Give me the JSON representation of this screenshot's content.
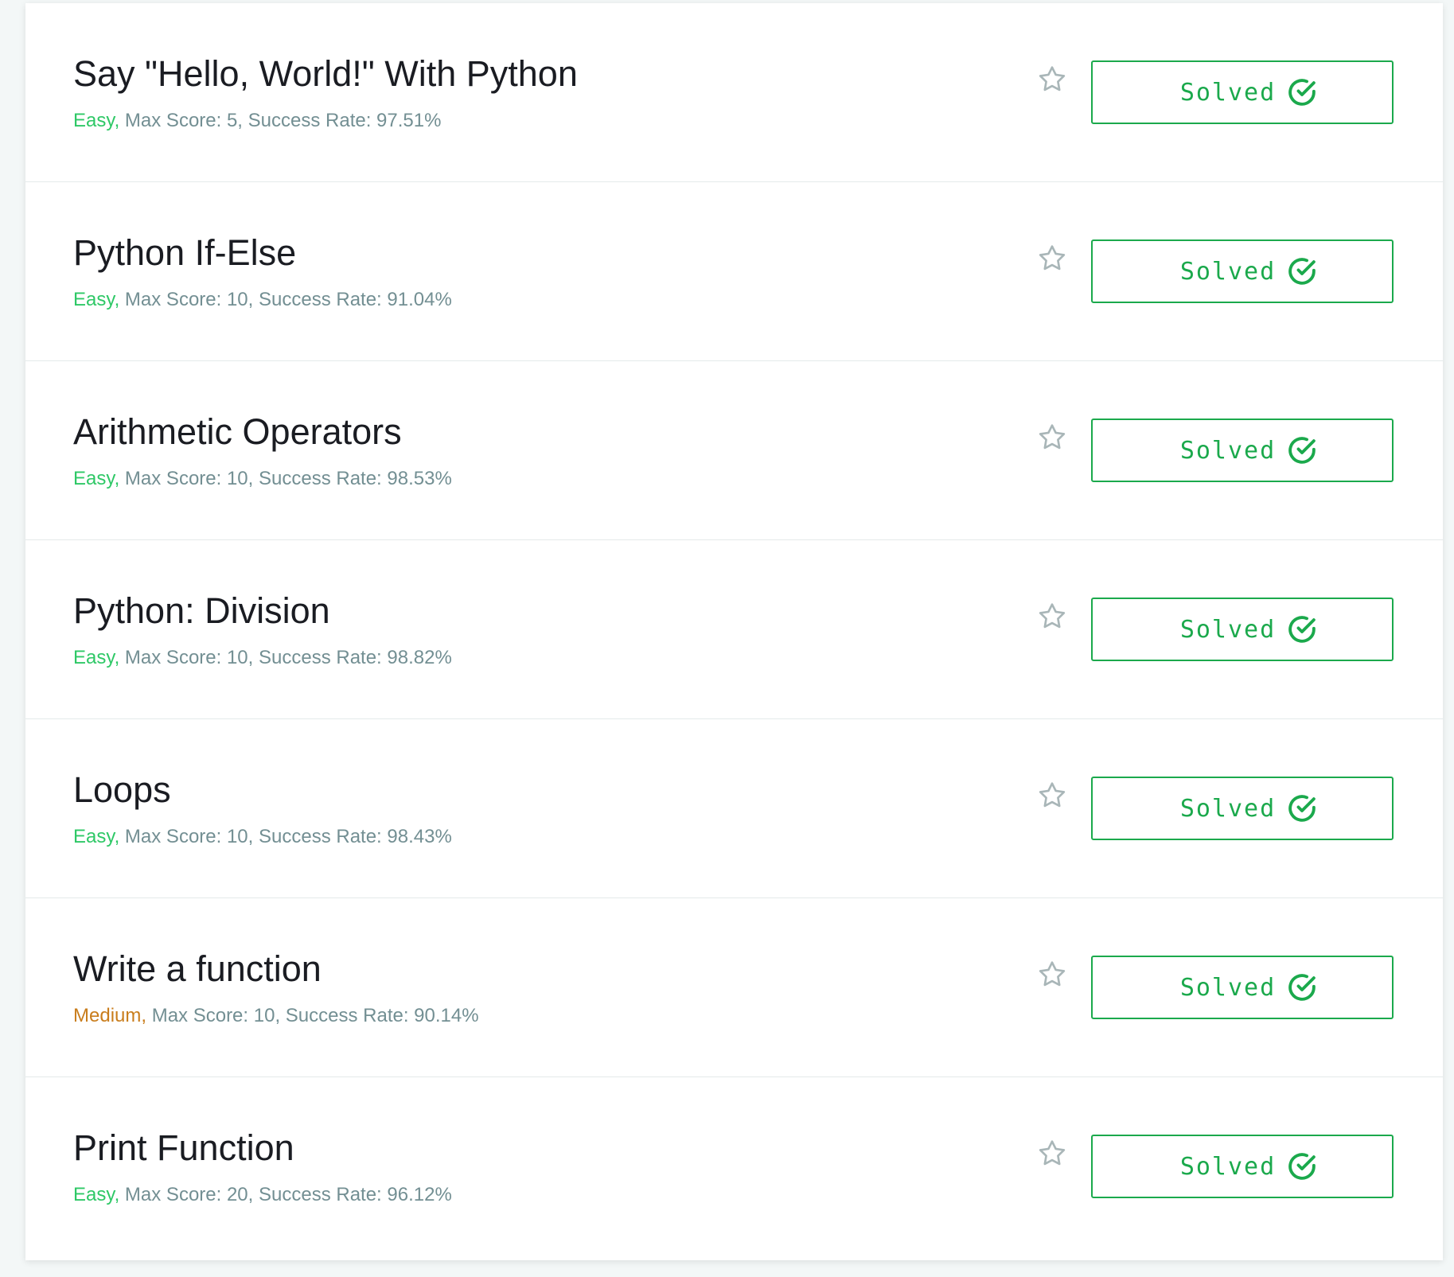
{
  "colors": {
    "easy": "#2ec866",
    "medium": "#c97d1c",
    "solved": "#1ba94c",
    "meta": "#738f93",
    "title": "#1a1c22"
  },
  "challenges": [
    {
      "title": "Say \"Hello, World!\" With Python",
      "difficulty": "Easy,",
      "difficulty_level": "easy",
      "stats": "Max Score: 5, Success Rate: 97.51%",
      "status": "Solved",
      "star_icon": "star-outline-icon",
      "status_icon": "check-circle-icon"
    },
    {
      "title": "Python If-Else",
      "difficulty": "Easy,",
      "difficulty_level": "easy",
      "stats": "Max Score: 10, Success Rate: 91.04%",
      "status": "Solved",
      "star_icon": "star-outline-icon",
      "status_icon": "check-circle-icon"
    },
    {
      "title": "Arithmetic Operators",
      "difficulty": "Easy,",
      "difficulty_level": "easy",
      "stats": "Max Score: 10, Success Rate: 98.53%",
      "status": "Solved",
      "star_icon": "star-outline-icon",
      "status_icon": "check-circle-icon"
    },
    {
      "title": "Python: Division",
      "difficulty": "Easy,",
      "difficulty_level": "easy",
      "stats": "Max Score: 10, Success Rate: 98.82%",
      "status": "Solved",
      "star_icon": "star-outline-icon",
      "status_icon": "check-circle-icon"
    },
    {
      "title": "Loops",
      "difficulty": "Easy,",
      "difficulty_level": "easy",
      "stats": "Max Score: 10, Success Rate: 98.43%",
      "status": "Solved",
      "star_icon": "star-outline-icon",
      "status_icon": "check-circle-icon"
    },
    {
      "title": "Write a function",
      "difficulty": "Medium,",
      "difficulty_level": "medium",
      "stats": "Max Score: 10, Success Rate: 90.14%",
      "status": "Solved",
      "star_icon": "star-outline-icon",
      "status_icon": "check-circle-icon"
    },
    {
      "title": "Print Function",
      "difficulty": "Easy,",
      "difficulty_level": "easy",
      "stats": "Max Score: 20, Success Rate: 96.12%",
      "status": "Solved",
      "star_icon": "star-outline-icon",
      "status_icon": "check-circle-icon"
    }
  ]
}
